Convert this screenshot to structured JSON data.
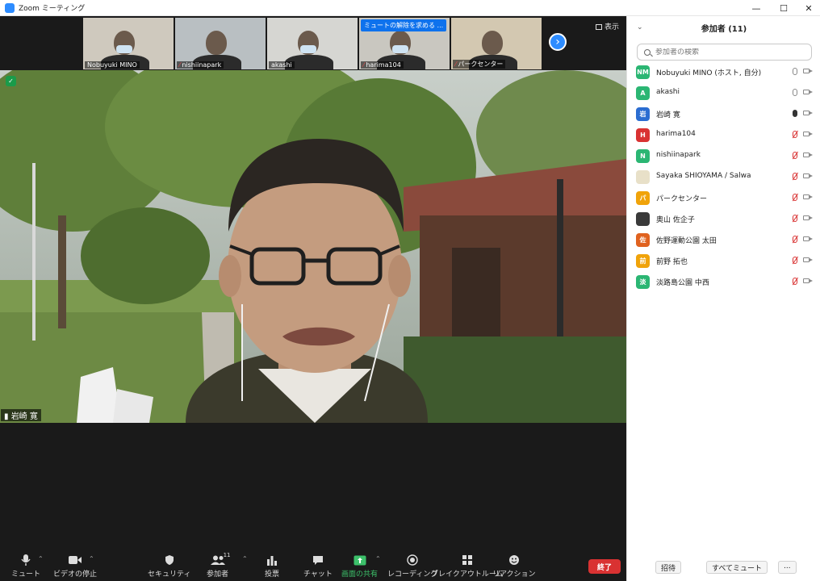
{
  "window": {
    "title": "Zoom ミーティング",
    "minimize": "—",
    "maximize": "☐",
    "close": "✕"
  },
  "thumbnails": [
    {
      "name": "Nobuyuki MINO",
      "muted": false,
      "bg": "#cfc9be",
      "mask": true
    },
    {
      "name": "nishiinapark",
      "muted": true,
      "bg": "#b9bfc2",
      "mask": false
    },
    {
      "name": "akashi",
      "muted": false,
      "bg": "#d6d6d2",
      "mask": true
    },
    {
      "name": "harima104",
      "muted": true,
      "bg": "#c9c7c0",
      "mask": true,
      "tooltip": "ミュートの解除を求める ..."
    },
    {
      "name": "パークセンター",
      "muted": true,
      "bg": "#d3c8b1",
      "mask": false
    }
  ],
  "view_label": "表示",
  "active_speaker": {
    "name": "岩崎 寛"
  },
  "toolbar": {
    "mute": "ミュート",
    "video": "ビデオの停止",
    "security": "セキュリティ",
    "participants": "参加者",
    "participants_count": "11",
    "poll": "投票",
    "chat": "チャット",
    "share": "画面の共有",
    "record": "レコーディング",
    "breakout": "ブレイクアウトルーム",
    "reaction": "リアクション",
    "end": "終了"
  },
  "panel": {
    "title": "参加者 (11)",
    "search_placeholder": "参加者の検索",
    "participants": [
      {
        "initials": "NM",
        "color": "#2bb673",
        "name": "Nobuyuki MINO (ホスト, 自分)",
        "mic": "normal",
        "cam": "normal"
      },
      {
        "initials": "A",
        "color": "#2bb673",
        "name": "akashi",
        "mic": "normal",
        "cam": "normal"
      },
      {
        "initials": "岩",
        "color": "#2b6dd1",
        "name": "岩崎 寛",
        "mic": "active",
        "cam": "normal"
      },
      {
        "initials": "H",
        "color": "#d93232",
        "name": "harima104",
        "mic": "off",
        "cam": "normal"
      },
      {
        "initials": "N",
        "color": "#2bb673",
        "name": "nishiinapark",
        "mic": "off",
        "cam": "normal"
      },
      {
        "initials": "",
        "color": "#e8e0c8",
        "name": "Sayaka SHIOYAMA / Salwa",
        "mic": "off",
        "cam": "normal"
      },
      {
        "initials": "パ",
        "color": "#f0a30a",
        "name": "パークセンター",
        "mic": "off",
        "cam": "normal"
      },
      {
        "initials": "",
        "color": "#3a3a3a",
        "name": "奥山 佐企子",
        "mic": "off",
        "cam": "normal"
      },
      {
        "initials": "佐",
        "color": "#e0621f",
        "name": "佐野運動公園  太田",
        "mic": "off",
        "cam": "normal"
      },
      {
        "initials": "前",
        "color": "#f0a30a",
        "name": "前野  拓也",
        "mic": "off",
        "cam": "normal"
      },
      {
        "initials": "淡",
        "color": "#2bb673",
        "name": "淡路島公園  中西",
        "mic": "off",
        "cam": "normal"
      }
    ],
    "invite": "招待",
    "mute_all": "すべてミュート",
    "more": "..."
  }
}
